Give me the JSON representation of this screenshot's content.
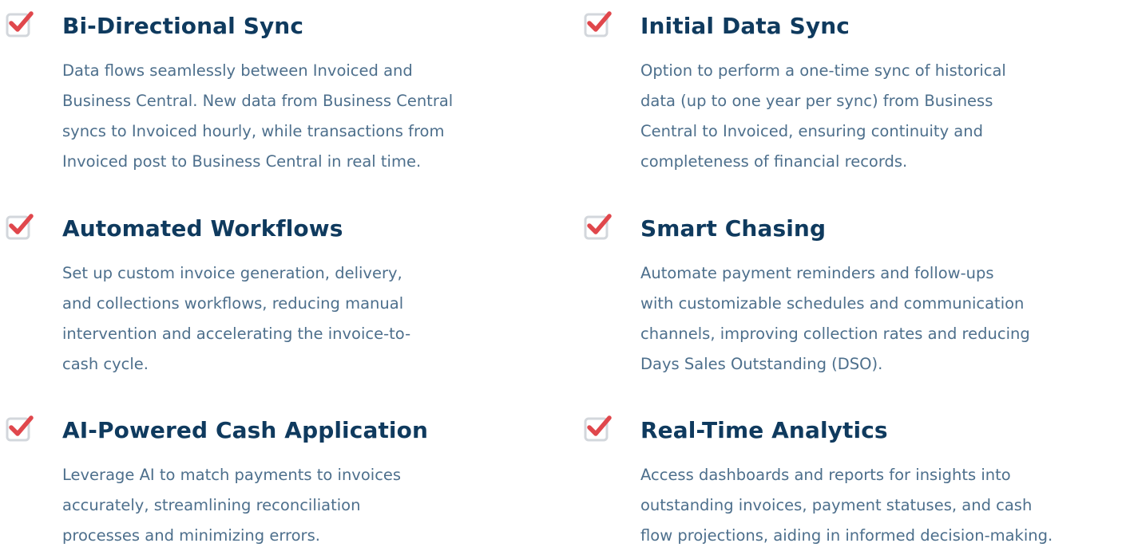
{
  "columns": [
    {
      "features": [
        {
          "title": "Bi-Directional Sync",
          "lines": [
            "Data flows seamlessly between Invoiced and",
            "Business Central. New data from Business Central",
            "syncs to Invoiced hourly, while transactions from",
            "Invoiced post to Business Central in real time."
          ]
        },
        {
          "title": "Automated Workflows",
          "lines": [
            "Set up custom invoice generation, delivery,",
            "and collections workflows, reducing manual",
            "intervention and accelerating the invoice-to-",
            "cash cycle."
          ]
        },
        {
          "title": "AI-Powered Cash Application",
          "lines": [
            "Leverage AI to match payments to invoices",
            "accurately, streamlining reconciliation",
            "processes and minimizing errors."
          ]
        }
      ]
    },
    {
      "features": [
        {
          "title": "Initial Data Sync",
          "lines": [
            "Option to perform a one-time sync of historical",
            "data (up to one year per sync) from Business",
            "Central to Invoiced, ensuring continuity and",
            "completeness of financial records."
          ]
        },
        {
          "title": "Smart Chasing",
          "lines": [
            "Automate payment reminders and follow-ups",
            "with customizable schedules and communication",
            "channels, improving collection rates and reducing",
            "Days Sales Outstanding (DSO)."
          ]
        },
        {
          "title": "Real-Time Analytics",
          "lines": [
            "Access dashboards and reports for insights into",
            "outstanding invoices, payment statuses, and cash",
            "flow projections, aiding in informed decision-making."
          ]
        }
      ]
    }
  ],
  "colors": {
    "title": "#0f3a5e",
    "body": "#4d6f8c",
    "check_mark": "#e0474c",
    "check_box_border": "#d3d7dc"
  },
  "icon": "checkbox-checked-icon"
}
